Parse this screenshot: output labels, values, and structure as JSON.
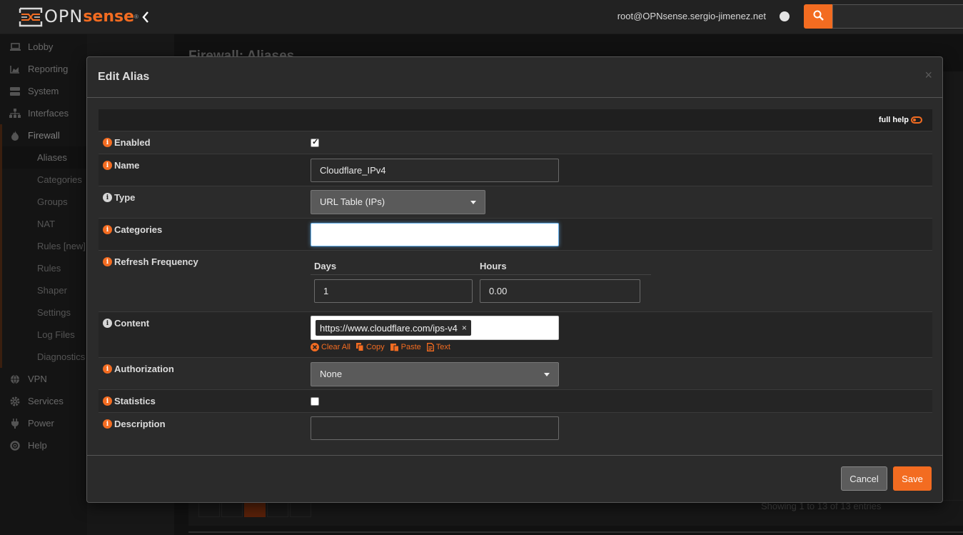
{
  "header": {
    "logo_opn": "OPN",
    "logo_sense": "sense",
    "logo_reg": "®",
    "collapse_icon": "chevron-left-icon",
    "user": "root@OPNsense.sergio-jimenez.net",
    "search_placeholder": ""
  },
  "sidebar": {
    "items": [
      {
        "label": "Lobby",
        "icon": "laptop-icon"
      },
      {
        "label": "Reporting",
        "icon": "area-chart-icon"
      },
      {
        "label": "System",
        "icon": "server-icon"
      },
      {
        "label": "Interfaces",
        "icon": "sitemap-icon"
      },
      {
        "label": "Firewall",
        "icon": "fire-icon"
      }
    ],
    "firewall_sub": [
      "Aliases",
      "Categories",
      "Groups",
      "NAT",
      "Rules [new]",
      "Rules",
      "Shaper",
      "Settings",
      "Log Files",
      "Diagnostics"
    ],
    "items_after": [
      {
        "label": "VPN",
        "icon": "globe-icon"
      },
      {
        "label": "Services",
        "icon": "cog-icon"
      },
      {
        "label": "Power",
        "icon": "plug-icon"
      },
      {
        "label": "Help",
        "icon": "life-ring-icon"
      }
    ]
  },
  "background": {
    "title": "Firewall: Aliases",
    "showing": "Showing 1 to 13 of 13 entries",
    "current_page": "1"
  },
  "modal": {
    "title": "Edit Alias",
    "close": "×",
    "full_help": "full help",
    "fields": {
      "enabled": {
        "label": "Enabled",
        "checked": true
      },
      "name": {
        "label": "Name",
        "value": "Cloudflare_IPv4"
      },
      "type": {
        "label": "Type",
        "value": "URL Table (IPs)"
      },
      "categories": {
        "label": "Categories",
        "value": ""
      },
      "refresh": {
        "label": "Refresh Frequency",
        "days_label": "Days",
        "hours_label": "Hours",
        "days": "1",
        "hours": "0.00"
      },
      "content": {
        "label": "Content",
        "tag": "https://www.cloudflare.com/ips-v4",
        "tag_remove": "×",
        "clear_all": "Clear All",
        "copy": "Copy",
        "paste": "Paste",
        "text": "Text"
      },
      "authorization": {
        "label": "Authorization",
        "value": "None"
      },
      "statistics": {
        "label": "Statistics",
        "checked": false
      },
      "description": {
        "label": "Description",
        "value": ""
      }
    },
    "cancel": "Cancel",
    "save": "Save"
  },
  "colors": {
    "accent": "#f36c21",
    "focus": "#66afe9"
  }
}
